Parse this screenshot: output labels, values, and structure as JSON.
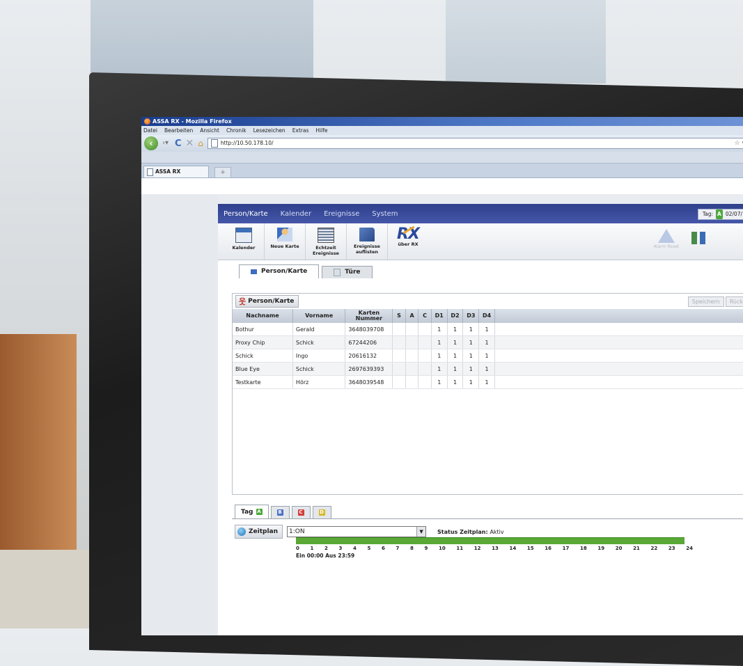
{
  "browser": {
    "window_title": "ASSA RX - Mozilla Firefox",
    "menu": [
      "Datei",
      "Bearbeiten",
      "Ansicht",
      "Chronik",
      "Lesezeichen",
      "Extras",
      "Hilfe"
    ],
    "url": "http://10.50.178.10/",
    "tab_label": "ASSA RX",
    "new_tab_symbol": "+"
  },
  "app": {
    "nav": [
      "Person/Karte",
      "Kalender",
      "Ereignisse",
      "System"
    ],
    "day_indicator": {
      "label": "Tag:",
      "badge": "A",
      "date": "02/07/"
    },
    "toolbar": {
      "kalender": "Kalender",
      "neue_karte": "Neue Karte",
      "echtzeit": "Echtzeit Ereignisse",
      "ereignisse": "Ereignisse auflisten",
      "logo": "RX",
      "ueber": "über RX",
      "alarm": "Alarm Reset"
    },
    "subtabs": [
      "Person/Karte",
      "Türe"
    ],
    "panel_title": "Person/Karte",
    "save_label": "Speichern",
    "back_label": "Rück",
    "table": {
      "headers": [
        "Nachname",
        "Vorname",
        "Karten Nummer",
        "S",
        "A",
        "C",
        "D1",
        "D2",
        "D3",
        "D4"
      ],
      "rows": [
        [
          "Bothur",
          "Gerald",
          "3648039708",
          "",
          "",
          "",
          "1",
          "1",
          "1",
          "1"
        ],
        [
          "Proxy Chip",
          "Schick",
          "67244206",
          "",
          "",
          "",
          "1",
          "1",
          "1",
          "1"
        ],
        [
          "Schick",
          "Ingo",
          "20616132",
          "",
          "",
          "",
          "1",
          "1",
          "1",
          "1"
        ],
        [
          "Blue Eye",
          "Schick",
          "2697639393",
          "",
          "",
          "",
          "1",
          "1",
          "1",
          "1"
        ],
        [
          "Testkarte",
          "Hörz",
          "3648039548",
          "",
          "",
          "",
          "1",
          "1",
          "1",
          "1"
        ]
      ]
    },
    "day_tabs": {
      "label": "Tag",
      "badges": [
        {
          "letter": "A",
          "color": "#4da83c"
        },
        {
          "letter": "B",
          "color": "#4a6fc6"
        },
        {
          "letter": "C",
          "color": "#d23b3b"
        },
        {
          "letter": "D",
          "color": "#d6b92c"
        }
      ]
    },
    "schedule": {
      "button": "Zeitplan",
      "selected": "1:ON",
      "status_label": "Status Zeitplan:",
      "status_value": "Aktiv",
      "progress_fraction": 1.0,
      "bar_color": "#5aa836",
      "ticks": [
        "0",
        "1",
        "2",
        "3",
        "4",
        "5",
        "6",
        "7",
        "8",
        "9",
        "10",
        "11",
        "12",
        "13",
        "14",
        "15",
        "16",
        "17",
        "18",
        "19",
        "20",
        "21",
        "22",
        "23",
        "24"
      ],
      "on_off": "Ein 00:00  Aus 23:59"
    }
  }
}
